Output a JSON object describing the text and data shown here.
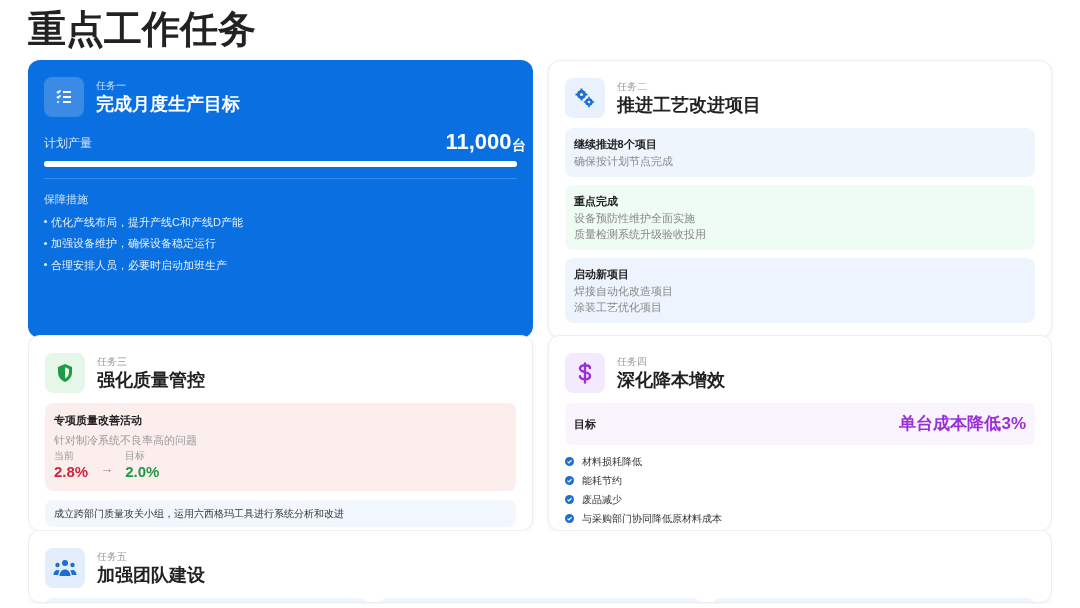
{
  "page_title": "重点工作任务",
  "tasks": [
    {
      "kind": "target",
      "featured": true,
      "label": "任务一",
      "title": "完成月度生产目标",
      "metric_label": "计划产量",
      "metric_value": "11,000",
      "metric_unit": "台",
      "level": 1,
      "section_label": "保障措施",
      "bullets": [
        "优化产线布局，提升产线C和产线D产能",
        "加强设备维护，确保设备稳定运行",
        "合理安排人员，必要时启动加班生产"
      ]
    },
    {
      "kind": "blocks",
      "featured": false,
      "label": "任务二",
      "title": "推进工艺改进项目",
      "blocks": [
        {
          "heading": "继续推进8个项目",
          "lines": [
            "确保按计划节点完成"
          ],
          "color": "#eff5fd"
        },
        {
          "heading": "重点完成",
          "lines": [
            "设备预防性维护全面实施",
            "质量检测系统升级验收投用"
          ],
          "color": "#effcf3"
        },
        {
          "heading": "启动新项目",
          "lines": [
            "焊接自动化改造项目",
            "涂装工艺优化项目"
          ],
          "color": "#eef4fd"
        }
      ]
    },
    {
      "kind": "quality",
      "featured": false,
      "label": "任务三",
      "title": "强化质量管控",
      "activity": {
        "heading": "专项质量改善活动",
        "desc": "针对制冷系统不良率高的问题",
        "current_label": "当前",
        "current": "2.8%",
        "arrow": "→",
        "target_label": "目标",
        "target": "2.0%"
      },
      "note": "成立跨部门质量攻关小组，运用六西格玛工具进行系统分析和改进"
    },
    {
      "kind": "cost",
      "featured": false,
      "label": "任务四",
      "title": "深化降本增效",
      "goal_label": "目标",
      "goal_value": "单台成本降低3%",
      "checklist": [
        "材料损耗降低",
        "能耗节约",
        "废品减少",
        "与采购部门协同降低原材料成本"
      ]
    },
    {
      "kind": "team",
      "featured": false,
      "label": "任务五",
      "title": "加强团队建设"
    }
  ]
}
